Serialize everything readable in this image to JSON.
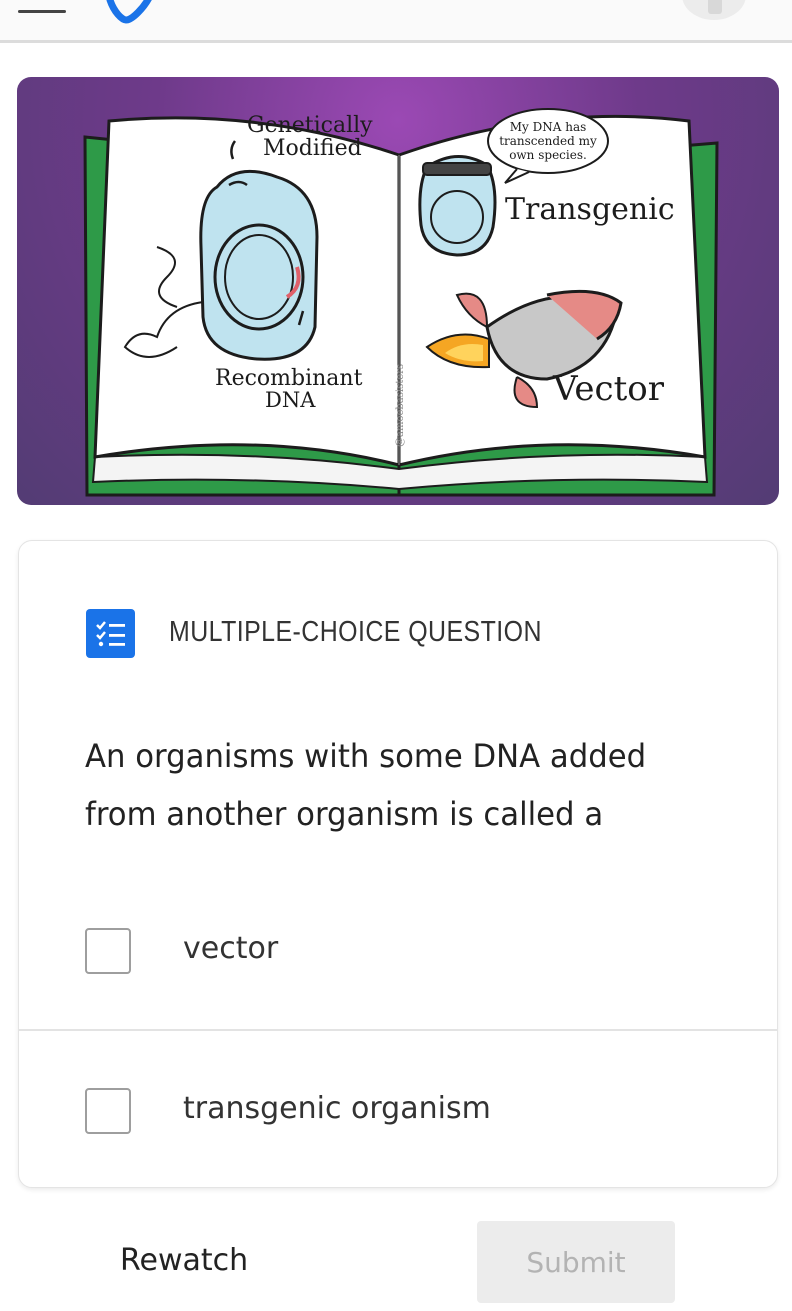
{
  "header": {
    "menu_icon": "hamburger-icon",
    "logo_icon": "app-logo-icon",
    "avatar_icon": "profile-avatar"
  },
  "hero": {
    "illustration": "open-book-biology-illustration",
    "labels": {
      "genetically": "Genetically",
      "modified": "Modified",
      "recombinant": "Recombinant",
      "dna": "DNA",
      "bubble_line1": "My DNA has",
      "bubble_line2": "transcended my",
      "bubble_line3": "own species.",
      "transgenic": "Transgenic",
      "vector": "Vector",
      "credit": "@amoebasisters"
    }
  },
  "question": {
    "type_icon": "checklist-icon",
    "type_label": "MULTIPLE-CHOICE QUESTION",
    "text": "An organisms with some DNA added from another organism is called a",
    "options": [
      {
        "label": "vector",
        "checked": false
      },
      {
        "label": "transgenic organism",
        "checked": false
      }
    ]
  },
  "footer": {
    "rewatch_label": "Rewatch",
    "submit_label": "Submit"
  },
  "colors": {
    "accent": "#1a73e8",
    "hero_purple": "#7b3f98",
    "book_green": "#2e9a48",
    "submit_bg": "#ececec",
    "submit_text": "#b3b3b3"
  }
}
